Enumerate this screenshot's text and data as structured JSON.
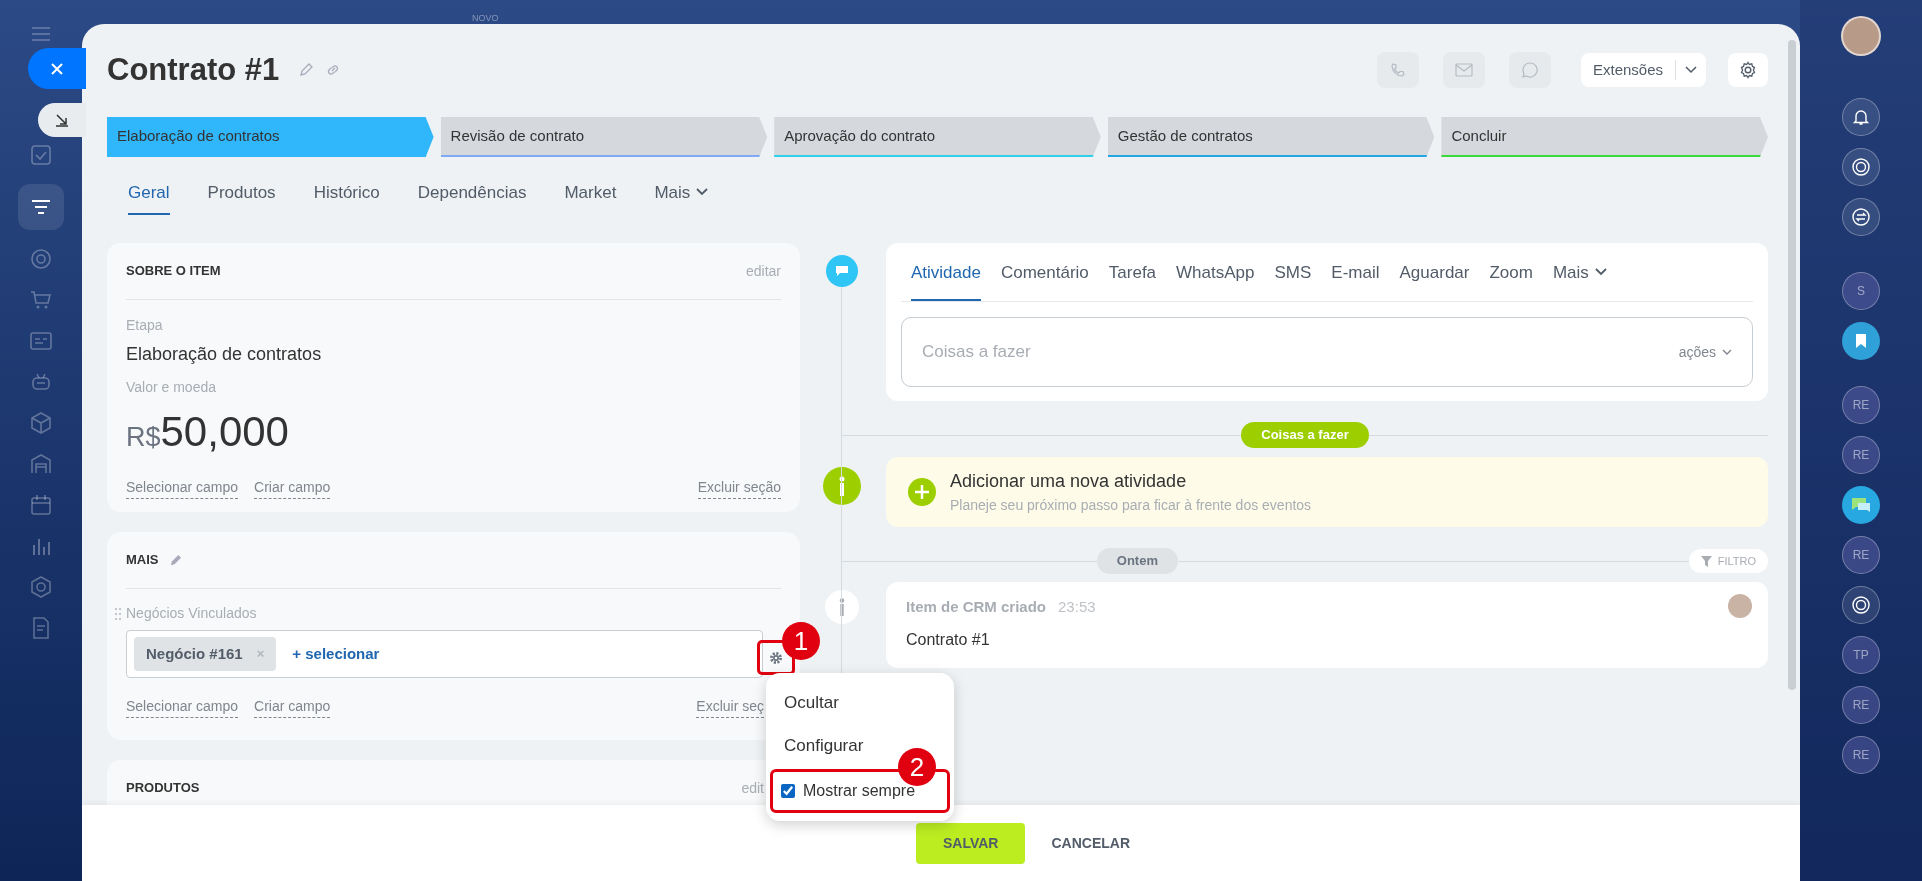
{
  "top_bar": {
    "label": "NOVO"
  },
  "window": {
    "title": "Contrato #1",
    "extensions_button": "Extensões"
  },
  "stages": [
    {
      "label": "Elaboração de contratos",
      "selected": true,
      "color": "#2fb6fb"
    },
    {
      "label": "Revisão de contrato",
      "selected": false,
      "color": "#7fa9f5"
    },
    {
      "label": "Aprovação do contrato",
      "selected": false,
      "color": "#2fd0e8"
    },
    {
      "label": "Gestão de contratos",
      "selected": false,
      "color": "#22a7e5"
    },
    {
      "label": "Concluir",
      "selected": false,
      "color": "#3bd83b"
    }
  ],
  "tabs": [
    {
      "label": "Geral",
      "selected": true
    },
    {
      "label": "Produtos",
      "selected": false
    },
    {
      "label": "Histórico",
      "selected": false
    },
    {
      "label": "Dependências",
      "selected": false
    },
    {
      "label": "Market",
      "selected": false
    },
    {
      "label": "Mais",
      "selected": false
    }
  ],
  "about_card": {
    "title": "SOBRE O ITEM",
    "edit": "editar",
    "fields": [
      {
        "label": "Etapa",
        "value": "Elaboração de contratos"
      }
    ],
    "amount_label": "Valor e moeda",
    "currency": "R$",
    "amount": "50,000",
    "links": [
      "Selecionar campo",
      "Criar campo"
    ],
    "delete_link": "Excluir seção"
  },
  "more_card": {
    "title": "MAIS",
    "field_label": "Negócios Vinculados",
    "tags": [
      {
        "label": "Negócio #161",
        "remove": "×"
      }
    ],
    "add_link": "+ selecionar",
    "links": [
      "Selecionar campo",
      "Criar campo"
    ],
    "delete_link": "Excluir seç"
  },
  "products_card": {
    "title": "PRODUTOS",
    "edit": "edit"
  },
  "field_menu": {
    "items": [
      {
        "kind": "action",
        "label": "Ocultar"
      },
      {
        "kind": "action",
        "label": "Configurar"
      },
      {
        "kind": "checkbox",
        "label": "Mostrar sempre",
        "checked": true
      }
    ]
  },
  "callouts": [
    "1",
    "2"
  ],
  "activity": {
    "tabs": [
      {
        "label": "Atividade",
        "selected": true
      },
      {
        "label": "Comentário",
        "selected": false
      },
      {
        "label": "Tarefa",
        "selected": false
      },
      {
        "label": "WhatsApp",
        "selected": false
      },
      {
        "label": "SMS",
        "selected": false
      },
      {
        "label": "E-mail",
        "selected": false
      },
      {
        "label": "Aguardar",
        "selected": false
      },
      {
        "label": "Zoom",
        "selected": false
      },
      {
        "label": "Mais",
        "selected": false
      }
    ],
    "placeholder": "Coisas a fazer",
    "actions": "ações"
  },
  "timeline": {
    "todo_badge": "Coisas a fazer",
    "add_title": "Adicionar uma nova atividade",
    "add_hint": "Planeje seu próximo passo para ficar à frente dos eventos",
    "day_badge": "Ontem",
    "filter": "FILTRO",
    "entry": {
      "title": "Item de CRM criado",
      "time": "23:53",
      "text": "Contrato #1"
    }
  },
  "footer": {
    "save": "SALVAR",
    "cancel": "CANCELAR"
  },
  "right_sidebar": [
    {
      "kind": "avatar"
    },
    {
      "kind": "bell"
    },
    {
      "kind": "spiral"
    },
    {
      "kind": "swap"
    },
    {
      "kind": "initials",
      "text": "S"
    },
    {
      "kind": "bookmark"
    },
    {
      "kind": "initials",
      "text": "RE"
    },
    {
      "kind": "initials",
      "text": "RE"
    },
    {
      "kind": "chat"
    },
    {
      "kind": "initials",
      "text": "RE"
    },
    {
      "kind": "spiral"
    },
    {
      "kind": "initials",
      "text": "TP"
    },
    {
      "kind": "initials",
      "text": "RE"
    },
    {
      "kind": "initials",
      "text": "RE"
    }
  ]
}
